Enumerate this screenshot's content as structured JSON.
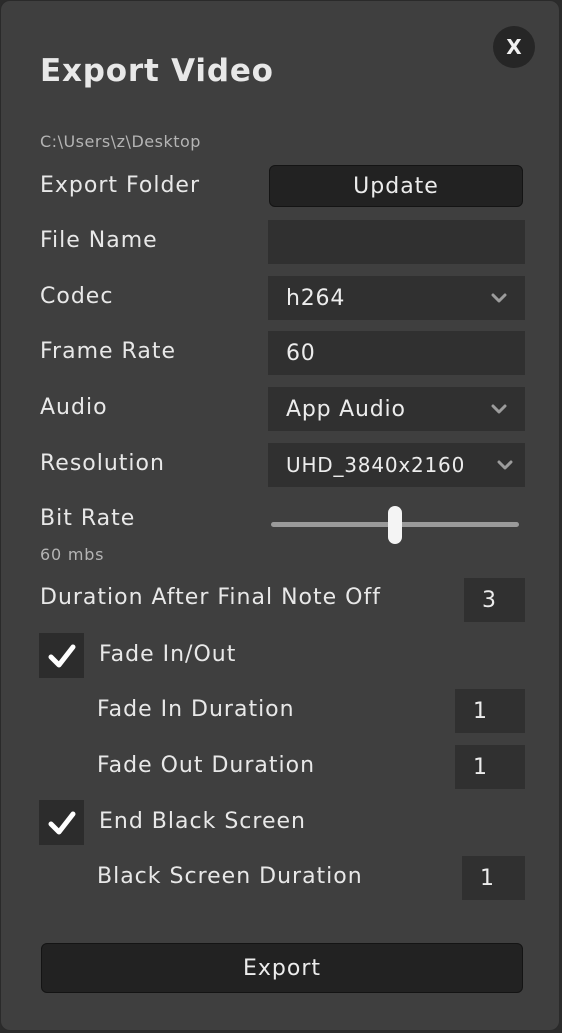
{
  "dialog": {
    "title": "Export Video",
    "close_label": "X",
    "export_path": "C:\\Users\\z\\Desktop"
  },
  "export_folder": {
    "label": "Export Folder",
    "button_label": "Update"
  },
  "file_name": {
    "label": "File Name",
    "value": ""
  },
  "codec": {
    "label": "Codec",
    "selected": "h264"
  },
  "frame_rate": {
    "label": "Frame Rate",
    "value": "60"
  },
  "audio": {
    "label": "Audio",
    "selected": "App Audio"
  },
  "resolution": {
    "label": "Resolution",
    "selected": "UHD_3840x2160"
  },
  "bit_rate": {
    "label": "Bit Rate",
    "value_text": "60 mbs",
    "slider_fraction": 0.5
  },
  "duration_after": {
    "label": "Duration After Final Note Off",
    "value": "3"
  },
  "fade": {
    "label": "Fade In/Out",
    "checked": true,
    "in_label": "Fade In Duration",
    "in_value": "1",
    "out_label": "Fade Out Duration",
    "out_value": "1"
  },
  "end_black": {
    "label": "End Black Screen",
    "checked": true,
    "duration_label": "Black Screen Duration",
    "duration_value": "1"
  },
  "export_button_label": "Export",
  "icons": {
    "close": "close-icon",
    "dropdown": "chevron-down-icon",
    "check": "checkmark-icon"
  },
  "colors": {
    "panel": "#3f3f3f",
    "field": "#303030",
    "button": "#222222",
    "text": "#e8e8e8"
  }
}
